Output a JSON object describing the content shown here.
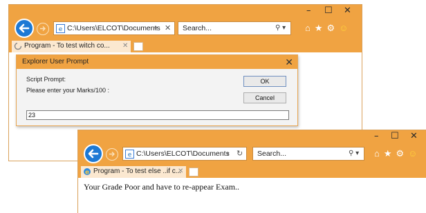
{
  "window1": {
    "address": "C:\\Users\\ELCOT\\Documents",
    "address_action": "✕",
    "search_placeholder": "Search...",
    "tab_label": "Program - To test witch co...",
    "dialog": {
      "title": "Explorer User Prompt",
      "script_label": "Script Prompt:",
      "prompt_text": "Please enter your Marks/100 :",
      "ok_label": "OK",
      "cancel_label": "Cancel",
      "input_value": "23"
    }
  },
  "window2": {
    "address": "C:\\Users\\ELCOT\\Documents",
    "address_action": "↻",
    "search_placeholder": "Search...",
    "tab_label": "Program - To test else ..if c...",
    "page_text": "Your Grade Poor and have to re-appear Exam.."
  },
  "colors": {
    "chrome": "#f0a342",
    "back_button": "#1d79d4",
    "dialog_bg": "#f3f3f3"
  },
  "icons": [
    "back-arrow-icon",
    "forward-arrow-icon",
    "ie-page-icon",
    "search-icon",
    "home-icon",
    "favorites-star-icon",
    "settings-gear-icon",
    "smiley-feedback-icon",
    "loading-spinner-icon",
    "close-icon",
    "minimize-icon",
    "maximize-icon"
  ]
}
